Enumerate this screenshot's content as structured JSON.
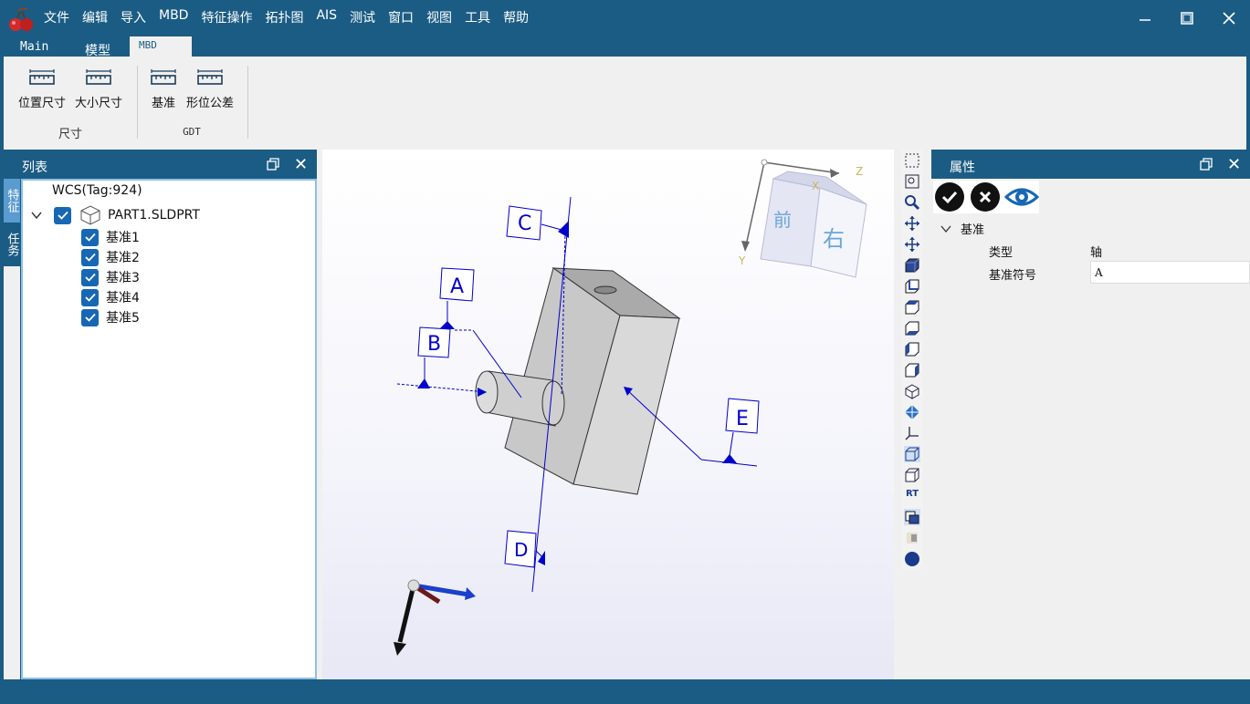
{
  "menu": [
    "文件",
    "编辑",
    "导入",
    "MBD",
    "特征操作",
    "拓扑图",
    "AIS",
    "测试",
    "窗口",
    "视图",
    "工具",
    "帮助"
  ],
  "ribbon_tabs": [
    "Main",
    "模型",
    "MBD"
  ],
  "ribbon": {
    "buttons": [
      "位置尺寸",
      "大小尺寸",
      "基准",
      "形位公差"
    ],
    "groups": [
      "尺寸",
      "GDT"
    ]
  },
  "left_panel": {
    "title": "列表",
    "side_tabs": [
      "特征",
      "任务"
    ],
    "tree": {
      "wcs": "WCS(Tag:924)",
      "part": "PART1.SLDPRT",
      "children": [
        "基准1",
        "基准2",
        "基准3",
        "基准4",
        "基准5"
      ]
    }
  },
  "viewport": {
    "datum_labels": [
      "C",
      "A",
      "B",
      "E",
      "D"
    ],
    "viewcube": {
      "face_front": "右",
      "face_left": "前",
      "axis_x": "X",
      "axis_y": "Y",
      "axis_z": "Z"
    }
  },
  "view_toolbar": {
    "rt_label": "RT"
  },
  "right_panel": {
    "title": "属性",
    "section": "基准",
    "props": [
      {
        "label": "类型",
        "value": "轴"
      },
      {
        "label": "基准符号",
        "value": "A"
      }
    ]
  },
  "colors": {
    "accent": "#1b5c84",
    "annotation": "#0000cc",
    "check": "#1767b5"
  }
}
